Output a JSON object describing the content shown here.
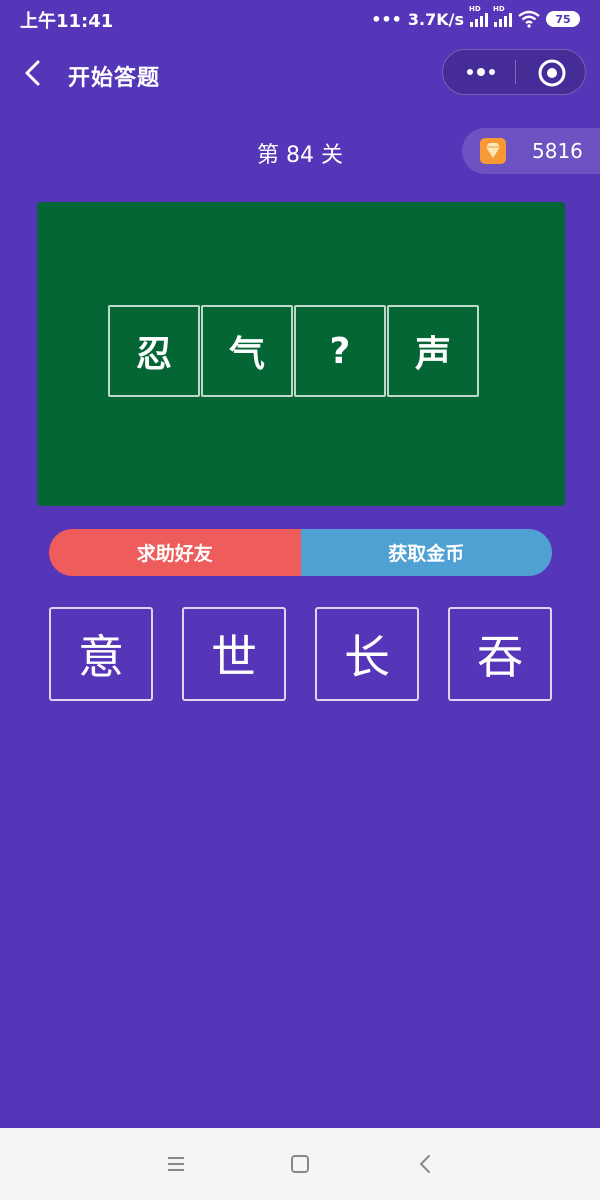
{
  "status_bar": {
    "time": "上午11:41",
    "network_speed": "3.7K/s",
    "signal_badge": "HD",
    "battery": "75"
  },
  "nav": {
    "title": "开始答题"
  },
  "game": {
    "level_text": "第 84 关",
    "coins": "5816",
    "puzzle_tiles": [
      "忍",
      "气",
      "?",
      "声"
    ],
    "actions": {
      "help_label": "求助好友",
      "coins_label": "获取金币",
      "help_color": "#ee5c5c",
      "coins_color": "#4fa0d3"
    },
    "options": [
      "意",
      "世",
      "长",
      "吞"
    ]
  },
  "colors": {
    "background": "#5536b9",
    "board": "#036634",
    "gem": "#f79a35"
  }
}
